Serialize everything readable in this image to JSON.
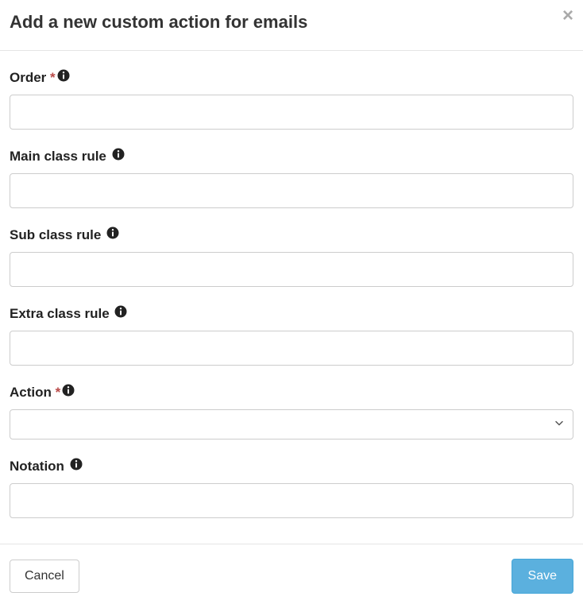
{
  "header": {
    "title": "Add a new custom action for emails"
  },
  "form": {
    "order": {
      "label": "Order",
      "required": "*",
      "value": ""
    },
    "main_class": {
      "label": "Main class rule",
      "value": ""
    },
    "sub_class": {
      "label": "Sub class rule",
      "value": ""
    },
    "extra_class": {
      "label": "Extra class rule",
      "value": ""
    },
    "action": {
      "label": "Action",
      "required": "*",
      "selected": ""
    },
    "notation": {
      "label": "Notation",
      "value": ""
    }
  },
  "footer": {
    "cancel": "Cancel",
    "save": "Save"
  }
}
